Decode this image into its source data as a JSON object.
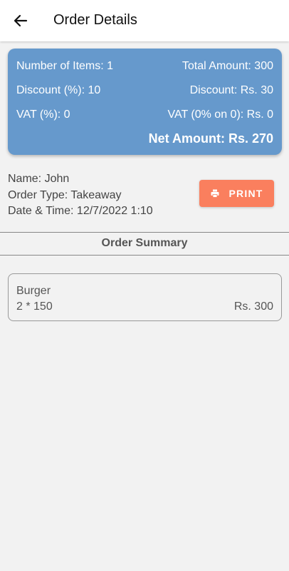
{
  "app_bar": {
    "title": "Order Details",
    "back_icon": "arrow-left-icon"
  },
  "summary": {
    "items_label": "Number of Items: 1",
    "total_label": "Total Amount: 300",
    "discount_pct_label": "Discount (%): 10",
    "discount_amt_label": "Discount: Rs. 30",
    "vat_pct_label": "VAT (%): 0",
    "vat_amt_label": "VAT (0% on 0): Rs. 0",
    "net_label": "Net Amount: Rs. 270",
    "color": "#6699cc"
  },
  "customer": {
    "name": "Name: John",
    "order_type": "Order Type: Takeaway",
    "datetime": "Date & Time: 12/7/2022 1:10"
  },
  "print_button": {
    "label": "PRINT",
    "icon": "printer-icon",
    "color": "#fa7f5e"
  },
  "order_summary": {
    "title": "Order Summary",
    "items": [
      {
        "name": "Burger",
        "qty_price": "2 * 150",
        "total": "Rs. 300"
      }
    ]
  }
}
